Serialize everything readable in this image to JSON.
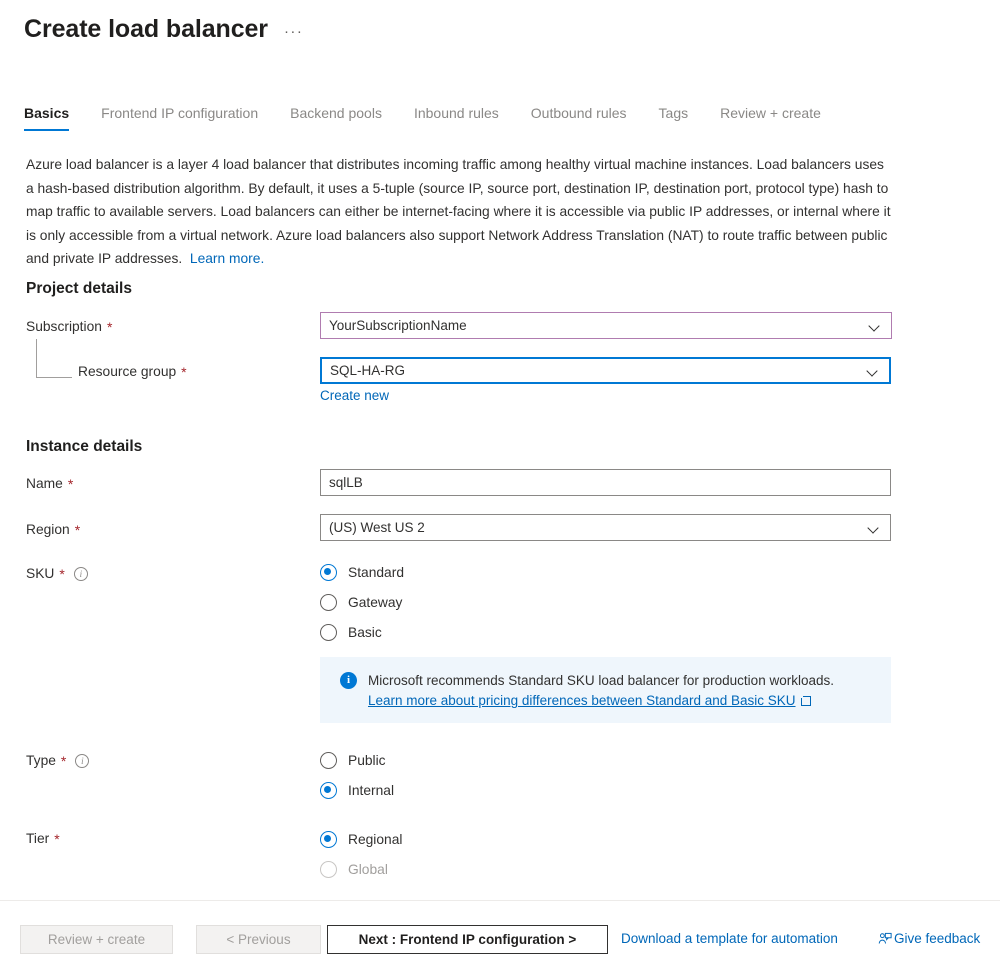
{
  "header": {
    "title": "Create load balancer",
    "more_menu": "···"
  },
  "tabs": [
    {
      "label": "Basics",
      "active": true
    },
    {
      "label": "Frontend IP configuration",
      "active": false
    },
    {
      "label": "Backend pools",
      "active": false
    },
    {
      "label": "Inbound rules",
      "active": false
    },
    {
      "label": "Outbound rules",
      "active": false
    },
    {
      "label": "Tags",
      "active": false
    },
    {
      "label": "Review + create",
      "active": false
    }
  ],
  "description": {
    "body": "Azure load balancer is a layer 4 load balancer that distributes incoming traffic among healthy virtual machine instances. Load balancers uses a hash-based distribution algorithm. By default, it uses a 5-tuple (source IP, source port, destination IP, destination port, protocol type) hash to map traffic to available servers. Load balancers can either be internet-facing where it is accessible via public IP addresses, or internal where it is only accessible from a virtual network. Azure load balancers also support Network Address Translation (NAT) to route traffic between public and private IP addresses.",
    "learn_more": "Learn more."
  },
  "project_details": {
    "heading": "Project details",
    "subscription": {
      "label": "Subscription",
      "required": "*",
      "value": "YourSubscriptionName",
      "border_color": "#b07cb0"
    },
    "resource_group": {
      "label": "Resource group",
      "required": "*",
      "value": "SQL-HA-RG",
      "border_color": "#0078d4",
      "create_new": "Create new"
    }
  },
  "instance_details": {
    "heading": "Instance details",
    "name": {
      "label": "Name",
      "required": "*",
      "value": "sqlLB"
    },
    "region": {
      "label": "Region",
      "required": "*",
      "value": "(US) West US 2"
    },
    "sku": {
      "label": "SKU",
      "required": "*",
      "info": "i",
      "options": [
        {
          "label": "Standard",
          "checked": true,
          "disabled": false
        },
        {
          "label": "Gateway",
          "checked": false,
          "disabled": false
        },
        {
          "label": "Basic",
          "checked": false,
          "disabled": false
        }
      ],
      "banner": {
        "icon": "info-icon",
        "text": "Microsoft recommends Standard SKU load balancer for production workloads.",
        "link": "Learn more about pricing differences between Standard and Basic SKU",
        "background": "#eff6fc"
      }
    },
    "type": {
      "label": "Type",
      "required": "*",
      "info": "i",
      "options": [
        {
          "label": "Public",
          "checked": false,
          "disabled": false
        },
        {
          "label": "Internal",
          "checked": true,
          "disabled": false
        }
      ]
    },
    "tier": {
      "label": "Tier",
      "required": "*",
      "options": [
        {
          "label": "Regional",
          "checked": true,
          "disabled": false
        },
        {
          "label": "Global",
          "checked": false,
          "disabled": true
        }
      ]
    }
  },
  "footer": {
    "review_create": "Review + create",
    "previous": "< Previous",
    "next": "Next : Frontend IP configuration >",
    "download_template": "Download a template for automation",
    "give_feedback": "Give feedback"
  },
  "colors": {
    "accent": "#0078d4",
    "link": "#0067b8",
    "required_asterisk": "#a4262c",
    "info_background": "#eff6fc"
  }
}
